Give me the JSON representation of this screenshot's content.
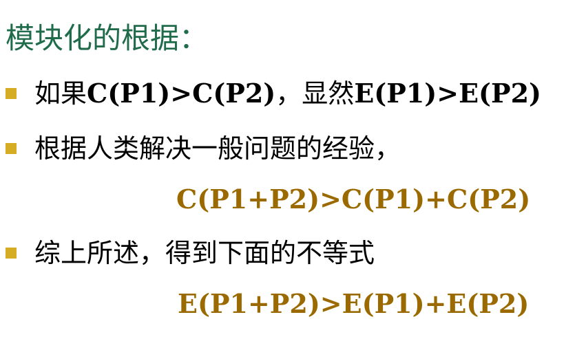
{
  "title": "模块化的根据：",
  "bullets": [
    {
      "prefix": "如果",
      "formula": "C(P1)>C(P2)",
      "suffix": "，显然",
      "tail": "E(P1)>E(P2)"
    },
    {
      "text": "根据人类解决一般问题的经验，"
    },
    {
      "text": "综上所述，得到下面的不等式"
    }
  ],
  "formulas": [
    "C(P1+P2)>C(P1)+C(P2)",
    "E(P1+P2)>E(P1)+E(P2)"
  ],
  "colors": {
    "title": "#1f6b4a",
    "bullet": "#d4ad24",
    "formula": "#9a6a00",
    "text": "#000000",
    "background": "#ffffff"
  }
}
